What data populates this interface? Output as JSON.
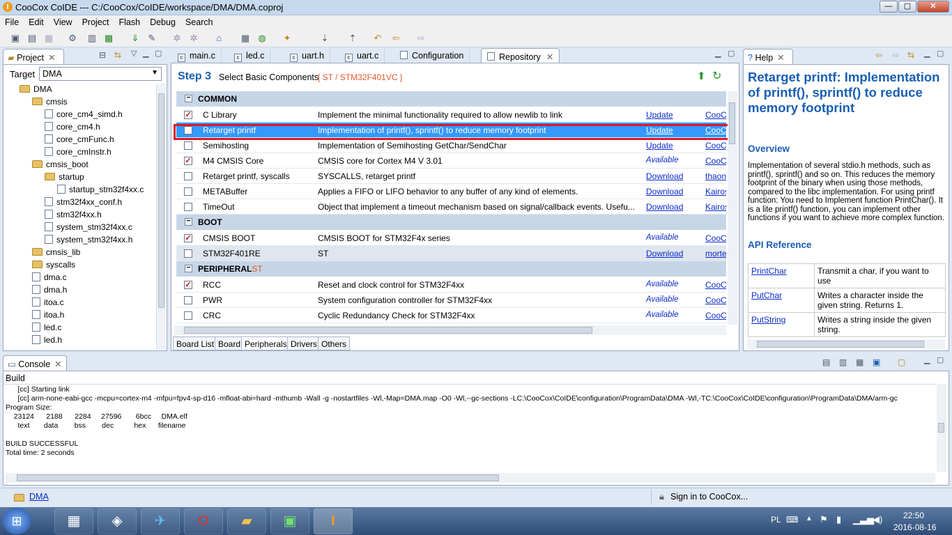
{
  "window": {
    "title": "CooCox CoIDE --- C:/CooCox/CoIDE/workspace/DMA/DMA.coproj",
    "min": "—",
    "max": "▢",
    "close": "✕"
  },
  "menu": [
    "File",
    "Edit",
    "View",
    "Project",
    "Flash",
    "Debug",
    "Search"
  ],
  "project_view": {
    "tab_label": "Project",
    "target_label": "Target",
    "target_value": "DMA",
    "tree": [
      {
        "label": "DMA",
        "kind": "folder",
        "level": 0
      },
      {
        "label": "cmsis",
        "kind": "folder",
        "level": 1
      },
      {
        "label": "core_cm4_simd.h",
        "kind": "file",
        "level": 2
      },
      {
        "label": "core_cm4.h",
        "kind": "file",
        "level": 2
      },
      {
        "label": "core_cmFunc.h",
        "kind": "file",
        "level": 2
      },
      {
        "label": "core_cmInstr.h",
        "kind": "file",
        "level": 2
      },
      {
        "label": "cmsis_boot",
        "kind": "folder",
        "level": 1
      },
      {
        "label": "startup",
        "kind": "folder",
        "level": 2
      },
      {
        "label": "startup_stm32f4xx.c",
        "kind": "file",
        "level": 3
      },
      {
        "label": "stm32f4xx_conf.h",
        "kind": "file",
        "level": 2
      },
      {
        "label": "stm32f4xx.h",
        "kind": "file",
        "level": 2
      },
      {
        "label": "system_stm32f4xx.c",
        "kind": "file",
        "level": 2
      },
      {
        "label": "system_stm32f4xx.h",
        "kind": "file",
        "level": 2
      },
      {
        "label": "cmsis_lib",
        "kind": "folder",
        "level": 1
      },
      {
        "label": "syscalls",
        "kind": "folder",
        "level": 1
      },
      {
        "label": "dma.c",
        "kind": "file",
        "level": 1
      },
      {
        "label": "dma.h",
        "kind": "file",
        "level": 1
      },
      {
        "label": "itoa.c",
        "kind": "file",
        "level": 1
      },
      {
        "label": "itoa.h",
        "kind": "file",
        "level": 1
      },
      {
        "label": "led.c",
        "kind": "file",
        "level": 1
      },
      {
        "label": "led.h",
        "kind": "file",
        "level": 1
      }
    ]
  },
  "editor_tabs": [
    {
      "label": "main.c"
    },
    {
      "label": "led.c"
    },
    {
      "label": "uart.h"
    },
    {
      "label": "uart.c"
    },
    {
      "label": "Configuration"
    },
    {
      "label": "Repository"
    }
  ],
  "repository": {
    "step": "Step 3",
    "step_text": "Select Basic Components",
    "chip": "[ ST / STM32F401VC ]",
    "sections": [
      {
        "title": "COMMON",
        "suffix": "",
        "rows": [
          {
            "checked": true,
            "name": "C Library",
            "desc": "Implement the minimal functionality required to allow newlib to link",
            "action": "Update",
            "author": "CooCox",
            "state": ""
          },
          {
            "checked": false,
            "name": "Retarget printf",
            "desc": "Implementation of printf(), sprintf() to reduce memory footprint",
            "action": "Update",
            "author": "CooCox",
            "state": "sel"
          },
          {
            "checked": false,
            "name": "Semihosting",
            "desc": "Implementation of Semihosting GetChar/SendChar",
            "action": "Update",
            "author": "CooCox",
            "state": ""
          },
          {
            "checked": true,
            "name": "M4 CMSIS Core",
            "desc": "CMSIS core for Cortex M4 V 3.01",
            "action": "Available",
            "author": "CooCox",
            "state": ""
          },
          {
            "checked": false,
            "name": "Retarget printf, syscalls",
            "desc": "SYSCALLS, retarget printf",
            "action": "Download",
            "author": "thaon",
            "state": ""
          },
          {
            "checked": false,
            "name": "METABuffer",
            "desc": "Applies a FIFO or LIFO behavior to any buffer of any kind of elements.",
            "action": "Download",
            "author": "Kairos",
            "state": ""
          },
          {
            "checked": false,
            "name": "TimeOut",
            "desc": "Object that implement a timeout mechanism based on signal/callback events. Usefu...",
            "action": "Download",
            "author": "Kairos",
            "state": ""
          }
        ]
      },
      {
        "title": "BOOT",
        "suffix": "",
        "rows": [
          {
            "checked": true,
            "name": "CMSIS BOOT",
            "desc": "CMSIS BOOT for STM32F4x series",
            "action": "Available",
            "author": "CooCox",
            "state": ""
          },
          {
            "checked": false,
            "name": "STM32F401RE",
            "desc": "ST",
            "action": "Download",
            "author": "morte",
            "state": "gray"
          }
        ]
      },
      {
        "title": "PERIPHERAL",
        "suffix": "ST",
        "rows": [
          {
            "checked": true,
            "name": "RCC",
            "desc": "Reset and clock control for STM32F4xx",
            "action": "Available",
            "author": "CooCox",
            "state": ""
          },
          {
            "checked": false,
            "name": "PWR",
            "desc": "System configuration controller for STM32F4xx",
            "action": "Available",
            "author": "CooCox",
            "state": ""
          },
          {
            "checked": false,
            "name": "CRC",
            "desc": "Cyclic Redundancy Check for STM32F4xx",
            "action": "Available",
            "author": "CooCox",
            "state": ""
          }
        ]
      }
    ],
    "bottom_tabs": [
      "Board List",
      "Board",
      "Peripherals",
      "Drivers",
      "Others"
    ]
  },
  "help": {
    "tab_label": "Help",
    "title": "Retarget printf: Implementation of printf(), sprintf() to reduce memory footprint",
    "overview_heading": "Overview",
    "overview_text": "Implementation of several stdio.h methods, such as printf(), sprintf() and so on. This reduces the memory footprint of the binary when using those methods, compared to the libc implementation. For using printf function: You need to Implement function PrintChar(). It is a lite printf() function, you can implement other functions if you want to achieve more complex function.",
    "api_heading": "API Reference",
    "api": [
      {
        "name": "PrintChar",
        "desc": "Transmit a char, if you want to use"
      },
      {
        "name": "PutChar",
        "desc": "Writes a character inside the given string. Returns 1."
      },
      {
        "name": "PutString",
        "desc": "Writes a string inside the given string."
      }
    ]
  },
  "console": {
    "tab_label": "Console",
    "subtitle": "Build",
    "lines": [
      "      [cc] Starting link",
      "      [cc] arm-none-eabi-gcc -mcpu=cortex-m4 -mfpu=fpv4-sp-d16 -mfloat-abi=hard -mthumb -Wall -g -nostartfiles -Wl,-Map=DMA.map -O0 -Wl,--gc-sections -LC:\\CooCox\\CoIDE\\configuration\\ProgramData\\DMA -Wl,-TC:\\CooCox\\CoIDE\\configuration\\ProgramData\\DMA/arm-gc",
      "Program Size:",
      "    23124      2188      2284     27596       6bcc     DMA.elf",
      "      text       data        bss        dec          hex      filename",
      "",
      "BUILD SUCCESSFUL",
      "Total time: 2 seconds"
    ]
  },
  "statusbar": {
    "project": "DMA",
    "signin": "Sign in to CooCox..."
  },
  "taskbar": {
    "lang": "PL",
    "time": "22:50",
    "date": "2016-08-16"
  }
}
